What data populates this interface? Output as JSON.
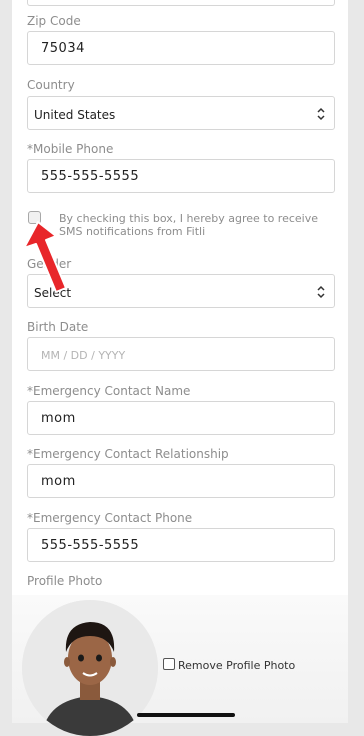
{
  "form": {
    "zip": {
      "label": "Zip Code",
      "value": "75034"
    },
    "country": {
      "label": "Country",
      "selected": "United States"
    },
    "mobile": {
      "label": "*Mobile Phone",
      "value": "555-555-5555"
    },
    "sms_consent": {
      "checked": false,
      "text": "By checking this box, I hereby agree to receive SMS notifications from Fitli"
    },
    "gender": {
      "label": "Gender",
      "selected": "Select"
    },
    "birth_date": {
      "label": "Birth Date",
      "placeholder": "MM / DD / YYYY"
    },
    "emergency_name": {
      "label": "*Emergency Contact Name",
      "value": "mom"
    },
    "emergency_relationship": {
      "label": "*Emergency Contact Relationship",
      "value": "mom"
    },
    "emergency_phone": {
      "label": "*Emergency Contact Phone",
      "value": "555-555-5555"
    },
    "profile_photo": {
      "label": "Profile Photo",
      "remove_label": "Remove Profile Photo",
      "remove_checked": false
    }
  },
  "colors": {
    "annotation_arrow": "#e8262a",
    "label": "#8d8d8d",
    "border": "#d6d6d6"
  }
}
